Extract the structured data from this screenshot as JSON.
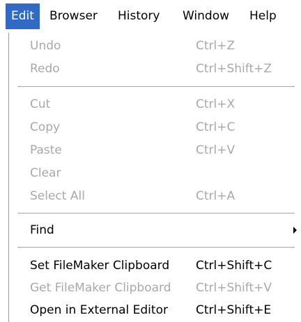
{
  "menubar": {
    "items": [
      {
        "label": "Edit",
        "active": true
      },
      {
        "label": "Browser"
      },
      {
        "label": "History"
      },
      {
        "label": "Window"
      },
      {
        "label": "Help"
      }
    ]
  },
  "menu": {
    "undo": {
      "label": "Undo",
      "shortcut": "Ctrl+Z",
      "enabled": false
    },
    "redo": {
      "label": "Redo",
      "shortcut": "Ctrl+Shift+Z",
      "enabled": false
    },
    "cut": {
      "label": "Cut",
      "shortcut": "Ctrl+X",
      "enabled": false
    },
    "copy": {
      "label": "Copy",
      "shortcut": "Ctrl+C",
      "enabled": false
    },
    "paste": {
      "label": "Paste",
      "shortcut": "Ctrl+V",
      "enabled": false
    },
    "clear": {
      "label": "Clear",
      "enabled": false
    },
    "select_all": {
      "label": "Select All",
      "shortcut": "Ctrl+A",
      "enabled": false
    },
    "find": {
      "label": "Find",
      "enabled": true,
      "submenu_icon": "submenu-arrow-icon"
    },
    "set_clipboard": {
      "label": "Set FileMaker Clipboard",
      "shortcut": "Ctrl+Shift+C",
      "enabled": true
    },
    "get_clipboard": {
      "label": "Get FileMaker Clipboard",
      "shortcut": "Ctrl+Shift+V",
      "enabled": false
    },
    "open_external": {
      "label": "Open in External Editor",
      "shortcut": "Ctrl+Shift+E",
      "enabled": true
    }
  },
  "colors": {
    "highlight": "#316ac5",
    "disabled_text": "#a8a8a8",
    "separator": "#a6a6a6"
  }
}
